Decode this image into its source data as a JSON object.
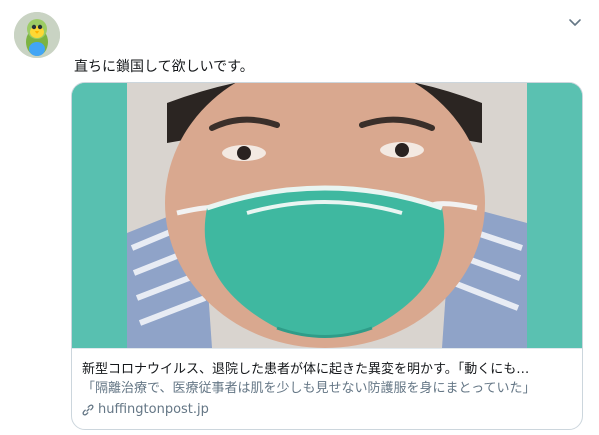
{
  "tweet": {
    "text": "直ちに鎖国して欲しいです。",
    "avatar_icon": "parrot-avatar",
    "menu_icon": "chevron-down-icon"
  },
  "card": {
    "image_description_icon": "masked-man-photo",
    "title": "新型コロナウイルス、退院した患者が体に起きた異変を明かす。「動くにも…",
    "description": "「隔離治療で、医療従事者は肌を少しも見せない防護服を身にまとっていた」",
    "domain": "huffingtonpost.jp",
    "domain_icon": "link-icon"
  },
  "colors": {
    "text_primary": "#14171a",
    "text_secondary": "#657786",
    "border": "#ccd6dd",
    "media_background": "#5fc4b5",
    "mask": "#3fb8a0"
  }
}
